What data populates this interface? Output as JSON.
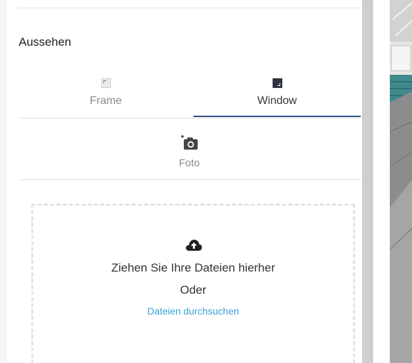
{
  "section": {
    "title": "Aussehen"
  },
  "tabs": [
    {
      "label": "Frame",
      "icon": "frame-icon",
      "active": false
    },
    {
      "label": "Window",
      "icon": "window-icon",
      "active": true
    }
  ],
  "photo": {
    "label": "Foto",
    "icon": "add-photo-icon"
  },
  "upload": {
    "icon": "cloud-upload-icon",
    "drop_text": "Ziehen Sie Ihre Dateien hierher",
    "or_text": "Oder",
    "browse_label": "Dateien durchsuchen"
  },
  "colors": {
    "accent": "#2d4c8e",
    "link": "#3aa0d8"
  }
}
